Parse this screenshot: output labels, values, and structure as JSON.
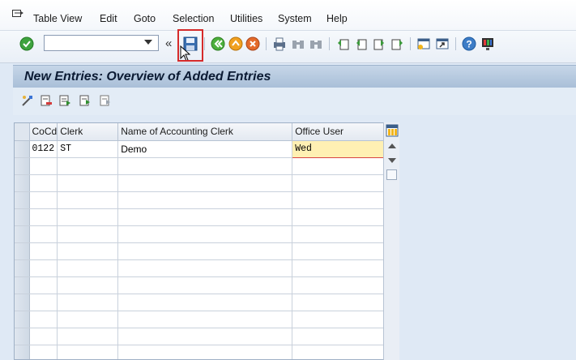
{
  "menubar": {
    "items": [
      {
        "label": "Table View"
      },
      {
        "label": "Edit"
      },
      {
        "label": "Goto"
      },
      {
        "label": "Selection"
      },
      {
        "label": "Utilities"
      },
      {
        "label": "System"
      },
      {
        "label": "Help"
      }
    ]
  },
  "toolbar": {
    "command_value": "",
    "chevrons": "«",
    "icons": [
      "enter-check-icon",
      "save-icon",
      "back-icon",
      "exit-icon",
      "cancel-icon",
      "print-icon",
      "find-icon",
      "find-next-icon",
      "first-page-icon",
      "previous-page-icon",
      "next-page-icon",
      "last-page-icon",
      "new-session-icon",
      "shortcut-icon",
      "help-icon",
      "customize-layout-icon"
    ]
  },
  "title": "New Entries: Overview of Added Entries",
  "app_toolbar": {
    "icons": [
      "change-display-icon",
      "delete-row-icon",
      "select-all-icon",
      "select-block-icon",
      "deselect-all-icon"
    ]
  },
  "table": {
    "columns": [
      {
        "label": "CoCd"
      },
      {
        "label": "Clerk"
      },
      {
        "label": "Name of Accounting Clerk"
      },
      {
        "label": "Office User"
      }
    ],
    "rows": [
      {
        "cocd": "0122",
        "clerk": "ST",
        "name": "Demo",
        "office_user": "Wed"
      }
    ]
  },
  "colors": {
    "highlight_border": "#d52b2b",
    "input_cell_bg": "#fff0b3",
    "title_bar": "#b8cbe0"
  }
}
